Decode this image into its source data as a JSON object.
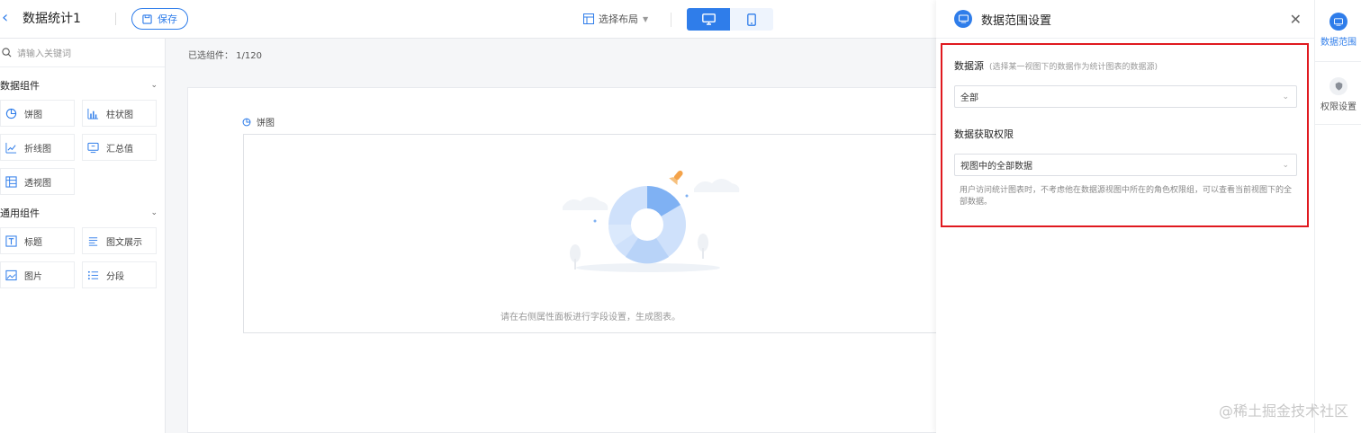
{
  "header": {
    "title": "数据统计1",
    "save_label": "保存",
    "layout_label": "选择布局"
  },
  "sidebar": {
    "search_placeholder": "请输入关键词",
    "groups": [
      {
        "title": "数据组件",
        "items": [
          "饼图",
          "柱状图",
          "折线图",
          "汇总值",
          "透视图"
        ]
      },
      {
        "title": "通用组件",
        "items": [
          "标题",
          "图文展示",
          "图片",
          "分段"
        ]
      }
    ]
  },
  "canvas": {
    "selected_label": "已选组件： 1/120",
    "widget_title": "饼图",
    "empty_hint": "请在右侧属性面板进行字段设置，生成图表。"
  },
  "panel": {
    "title": "数据范围设置",
    "datasource_label": "数据源",
    "datasource_note": "(选择某一视图下的数据作为统计图表的数据源)",
    "datasource_value": "全部",
    "permission_label": "数据获取权限",
    "permission_value": "视图中的全部数据",
    "help_text": "用户访问统计图表时，不考虑他在数据源视图中所在的角色权限组，可以查看当前视图下的全部数据。"
  },
  "side_tabs": [
    {
      "label": "数据范围",
      "active": true
    },
    {
      "label": "权限设置",
      "active": false
    }
  ],
  "watermark": "@稀土掘金技术社区",
  "colors": {
    "accent": "#2f7dea",
    "highlight": "#e0191f"
  }
}
